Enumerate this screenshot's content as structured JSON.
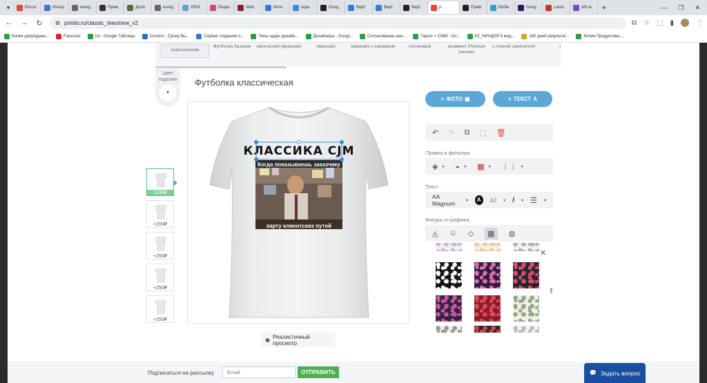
{
  "browser": {
    "tabs": [
      {
        "label": "Росси",
        "color": "#e14b3c"
      },
      {
        "label": "Интер",
        "color": "#4a72c9"
      },
      {
        "label": "everg",
        "color": "#666666"
      },
      {
        "label": "Прим",
        "color": "#333333"
      },
      {
        "label": "Допо",
        "color": "#5b6b4a"
      },
      {
        "label": "everg",
        "color": "#666666"
      },
      {
        "label": "VR/A",
        "color": "#6aa0d8"
      },
      {
        "label": "Разра",
        "color": "#d04a7a"
      },
      {
        "label": "Web",
        "color": "#8a1f2a"
      },
      {
        "label": "Инте",
        "color": "#3b7ad9"
      },
      {
        "label": "скри",
        "color": "#4285f4"
      },
      {
        "label": "Goog",
        "color": "#222222"
      },
      {
        "label": "Вирт",
        "color": "#3b7ad9"
      },
      {
        "label": "Вирт",
        "color": "#3b7ad9"
      },
      {
        "label": "Вирт",
        "color": "#222222"
      },
      {
        "label": "р",
        "color": "#e14b3c"
      },
      {
        "label": "Прим",
        "color": "#222222"
      },
      {
        "label": "Моби",
        "color": "#2aa3c7"
      },
      {
        "label": "Goog",
        "color": "#2a1b6b"
      },
      {
        "label": "Lamo",
        "color": "#c0392b"
      },
      {
        "label": "AR-ю",
        "color": "#7b4ad9"
      }
    ],
    "url": "printio.ru/classic_tees/new_v2",
    "bookmarks": [
      "Копия допродажн...",
      "Facecast",
      "Ux - Google Таблицы",
      "Coolors - Супер бы...",
      "Сервис создания о...",
      "Типы задач дизайн...",
      "Дизайнеры - Googl...",
      "Согласование цен...",
      "Таргет + СММ - Go...",
      "КЗ_НИНДЗЯ 5 мод...",
      "180 дней результат...",
      "Копия Продуктовы..."
    ]
  },
  "product_strip": [
    {
      "label": "классическая",
      "selected": true
    },
    {
      "label": "Футболка базовая",
      "selected": false
    },
    {
      "label": "запечаткой (мужская)",
      "selected": false
    },
    {
      "label": "оверсайз",
      "selected": false
    },
    {
      "label": "оверсайз с карманом",
      "selected": false
    },
    {
      "label": "хлопковый",
      "selected": false
    },
    {
      "label": "экзамент Premium унисекс",
      "selected": false
    },
    {
      "label": "с полной запечаткой",
      "selected": false
    },
    {
      "label": "а",
      "selected": false
    }
  ],
  "color_picker": {
    "label": "Цвет изделия",
    "caret": "▾"
  },
  "title": "Футболка классическая",
  "design": {
    "headline": "КЛАССИКА CJM",
    "caption_top": "Когда показываешь заказчику",
    "caption_bottom": "карту клиентских путей"
  },
  "thumbnails": [
    {
      "price": "1190₽",
      "active": true
    },
    {
      "price": "+200₽",
      "active": false
    },
    {
      "price": "+250₽",
      "active": false
    },
    {
      "price": "+250₽",
      "active": false
    },
    {
      "price": "+250₽",
      "active": false
    }
  ],
  "realistic_view": "Реалистичный просмотр",
  "editor": {
    "add_photo": "ФОТО",
    "add_text": "ТЕКСТ",
    "filters_label": "Правка и фильтры",
    "text_label": "Текст",
    "font": "AA Magnum",
    "font_color_letter": "A",
    "font_size": "42",
    "shapes_label": "Фигуры и графика"
  },
  "patterns": [
    {
      "bg": "#f3eef4",
      "fg": "#c9b8d0"
    },
    {
      "bg": "#fbeedd",
      "fg": "#e8c9a0"
    },
    {
      "bg": "#f0f0f0",
      "fg": "#b0b0b0"
    },
    {
      "bg": "#151515",
      "fg": "#ffffff"
    },
    {
      "bg": "#2a1f3a",
      "fg": "#e06bb0"
    },
    {
      "bg": "#1f2a2e",
      "fg": "#e24a6a"
    },
    {
      "bg": "#3a2244",
      "fg": "#c45aa0"
    },
    {
      "bg": "#8a1a2a",
      "fg": "#d94a5a"
    },
    {
      "bg": "#f4f0e6",
      "fg": "#8fa88a"
    },
    {
      "bg": "#eeeeee",
      "fg": "#999999"
    },
    {
      "bg": "#2a2a2a",
      "fg": "#cc4444"
    },
    {
      "bg": "#f4f4f4",
      "fg": "#bbbbbb"
    }
  ],
  "footer": {
    "subscribe": "Подписаться на рассылку",
    "email_placeholder": "Email",
    "send": "ОТПРАВИТЬ",
    "ask": "Задать вопрос"
  },
  "colors": {
    "accent": "#5aa7d8",
    "send_green": "#4caf50",
    "ask_blue": "#1a4fa0",
    "selection": "#3d8be0"
  }
}
